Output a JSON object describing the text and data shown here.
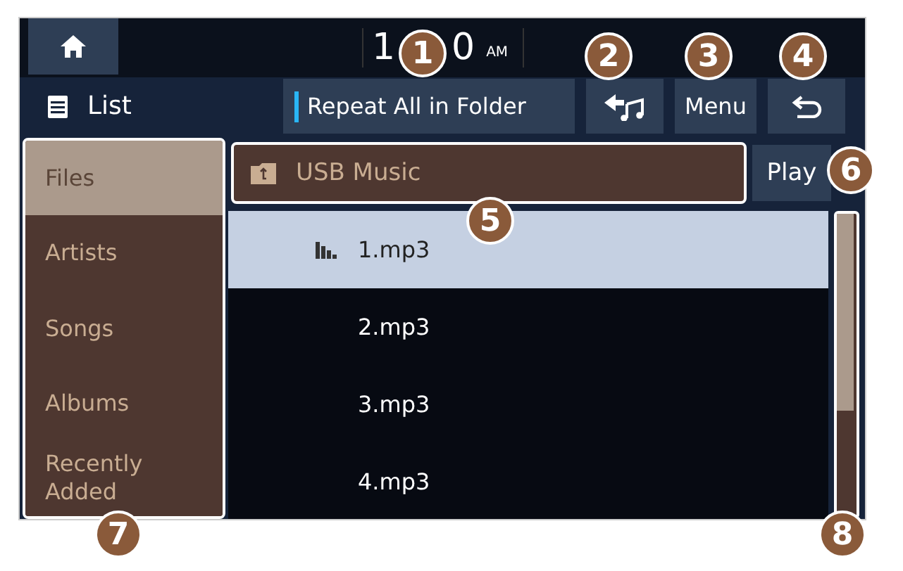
{
  "clock": {
    "start": "1",
    "end": "0",
    "period": "AM"
  },
  "toolbar": {
    "title": "List",
    "buttons": [
      {
        "kind": "repeat",
        "label": "Repeat All in Folder",
        "on": true
      },
      {
        "kind": "mode"
      },
      {
        "kind": "text",
        "label": "Menu"
      },
      {
        "kind": "back"
      }
    ]
  },
  "sidebar": {
    "items": [
      {
        "label": "Files",
        "selected": true
      },
      {
        "label": "Artists",
        "selected": false
      },
      {
        "label": "Songs",
        "selected": false
      },
      {
        "label": "Albums",
        "selected": false
      },
      {
        "label": "Recently Added",
        "selected": false
      }
    ]
  },
  "folder": {
    "name": "USB Music"
  },
  "play_button": "Play",
  "files": [
    {
      "name": "1.mp3",
      "selected": true,
      "playing": true
    },
    {
      "name": "2.mp3",
      "selected": false,
      "playing": false
    },
    {
      "name": "3.mp3",
      "selected": false,
      "playing": false
    },
    {
      "name": "4.mp3",
      "selected": false,
      "playing": false
    }
  ],
  "callouts": [
    "1",
    "2",
    "3",
    "4",
    "5",
    "6",
    "7",
    "8"
  ]
}
